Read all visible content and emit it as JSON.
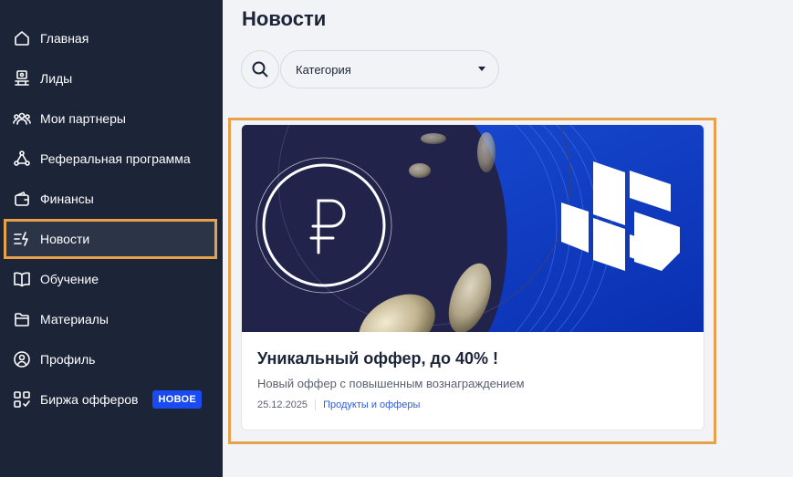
{
  "sidebar": {
    "items": [
      {
        "label": "Главная",
        "icon": "home-icon"
      },
      {
        "label": "Лиды",
        "icon": "leads-icon"
      },
      {
        "label": "Мои партнеры",
        "icon": "partners-icon"
      },
      {
        "label": "Реферальная программа",
        "icon": "referral-icon"
      },
      {
        "label": "Финансы",
        "icon": "wallet-icon"
      },
      {
        "label": "Новости",
        "icon": "news-icon",
        "active": true
      },
      {
        "label": "Обучение",
        "icon": "book-icon"
      },
      {
        "label": "Материалы",
        "icon": "folder-icon"
      },
      {
        "label": "Профиль",
        "icon": "profile-icon"
      },
      {
        "label": "Биржа офферов",
        "icon": "offers-grid-icon",
        "badge": "НОВОЕ"
      }
    ]
  },
  "main": {
    "title": "Новости",
    "search_icon": "search-icon",
    "category_label": "Категория"
  },
  "news": [
    {
      "title": "Уникальный оффер, до 40% !",
      "description": "Новый оффер с повышенным вознаграждением",
      "date": "25.12.2025",
      "category": "Продукты и офферы"
    }
  ],
  "colors": {
    "sidebar_bg": "#1c2438",
    "highlight": "#e8a14a",
    "badge_bg": "#1a4bf0",
    "link": "#2b5ce6"
  }
}
